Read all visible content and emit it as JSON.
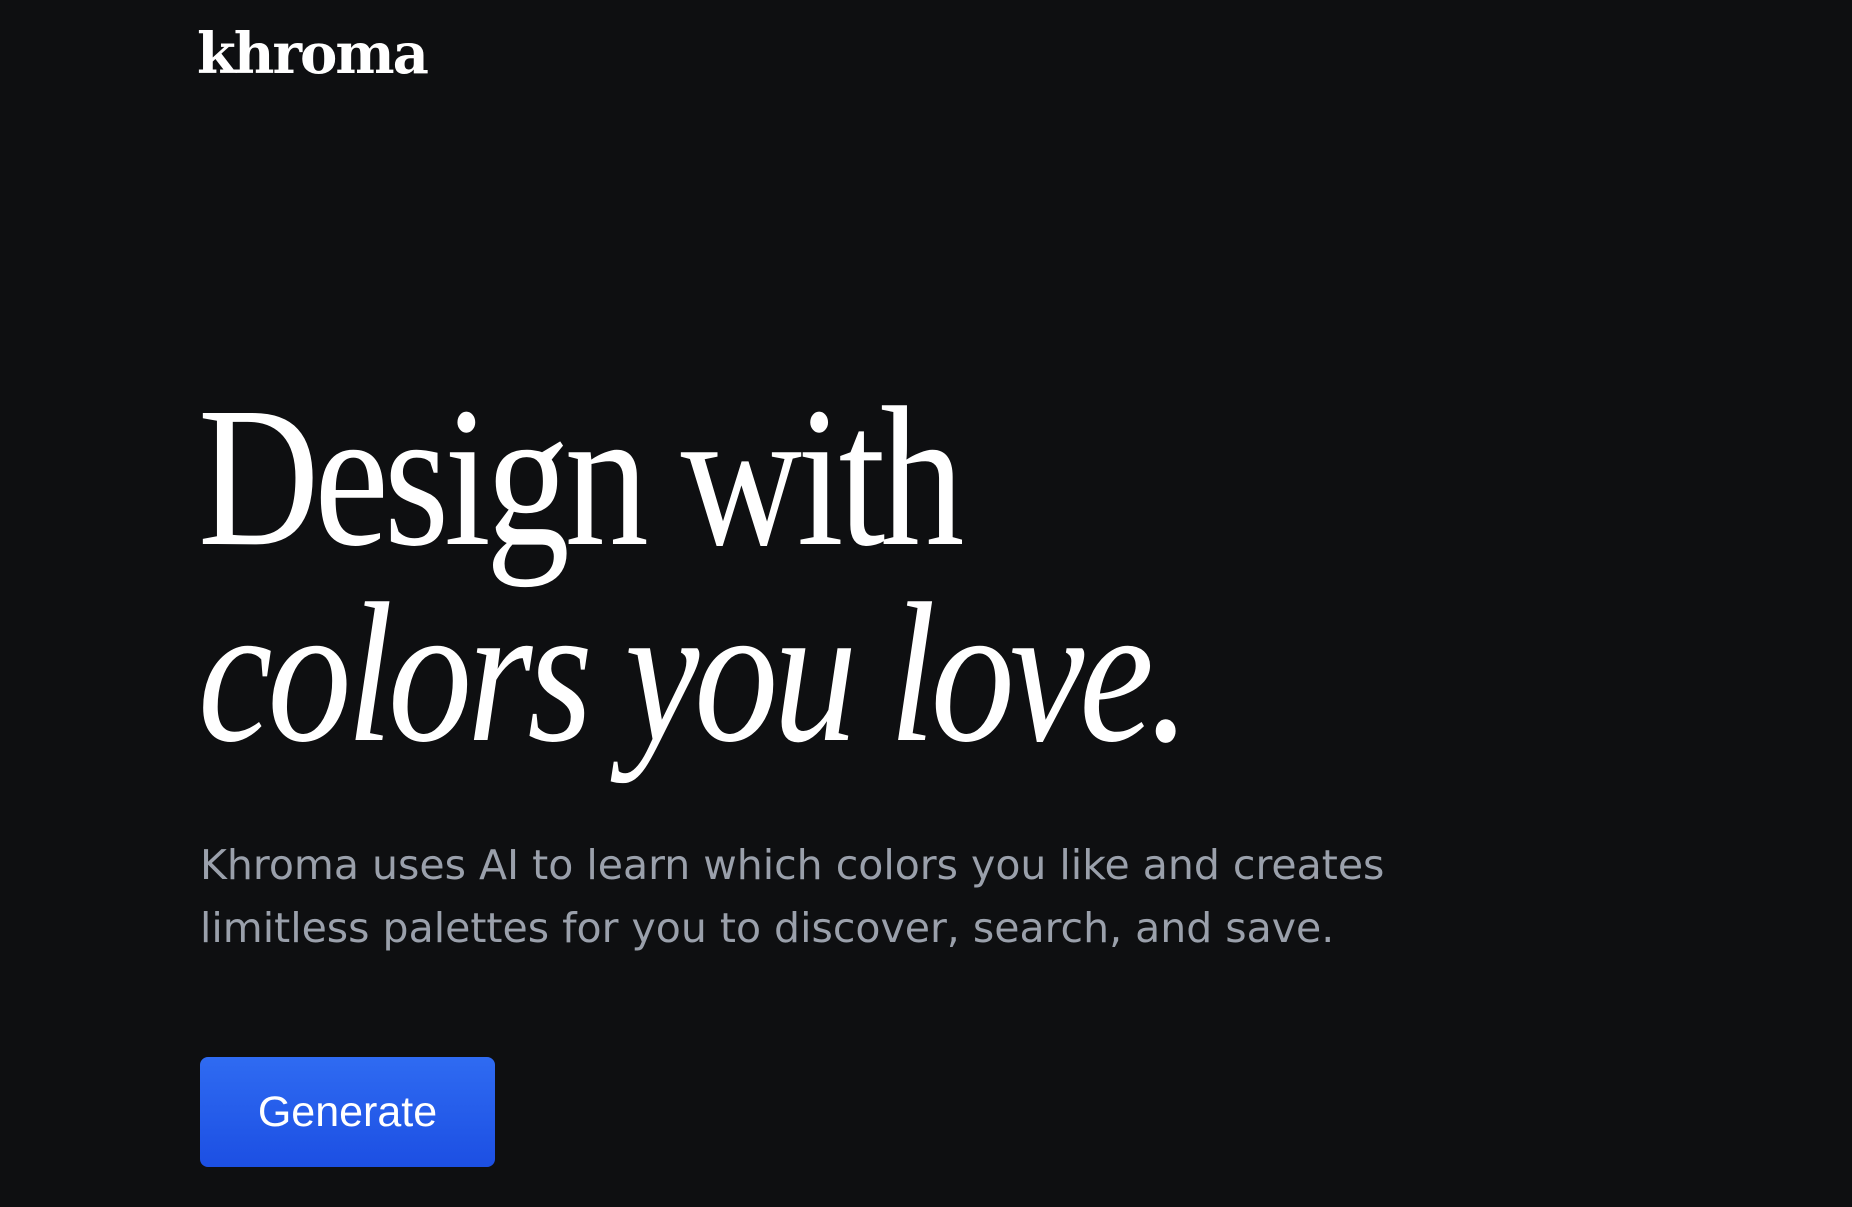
{
  "brand": {
    "logo_text": "khroma"
  },
  "hero": {
    "headline_line1": "Design with",
    "headline_line2": "colors you love.",
    "subtitle": "Khroma uses AI to learn which colors you like and creates limitless palettes for you to discover, search, and save.",
    "cta_label": "Generate"
  },
  "colors": {
    "background": "#0e0f11",
    "headline": "#ffffff",
    "subtitle": "#9aa0ab",
    "button": "#2360ee",
    "button_text": "#ffffff"
  }
}
